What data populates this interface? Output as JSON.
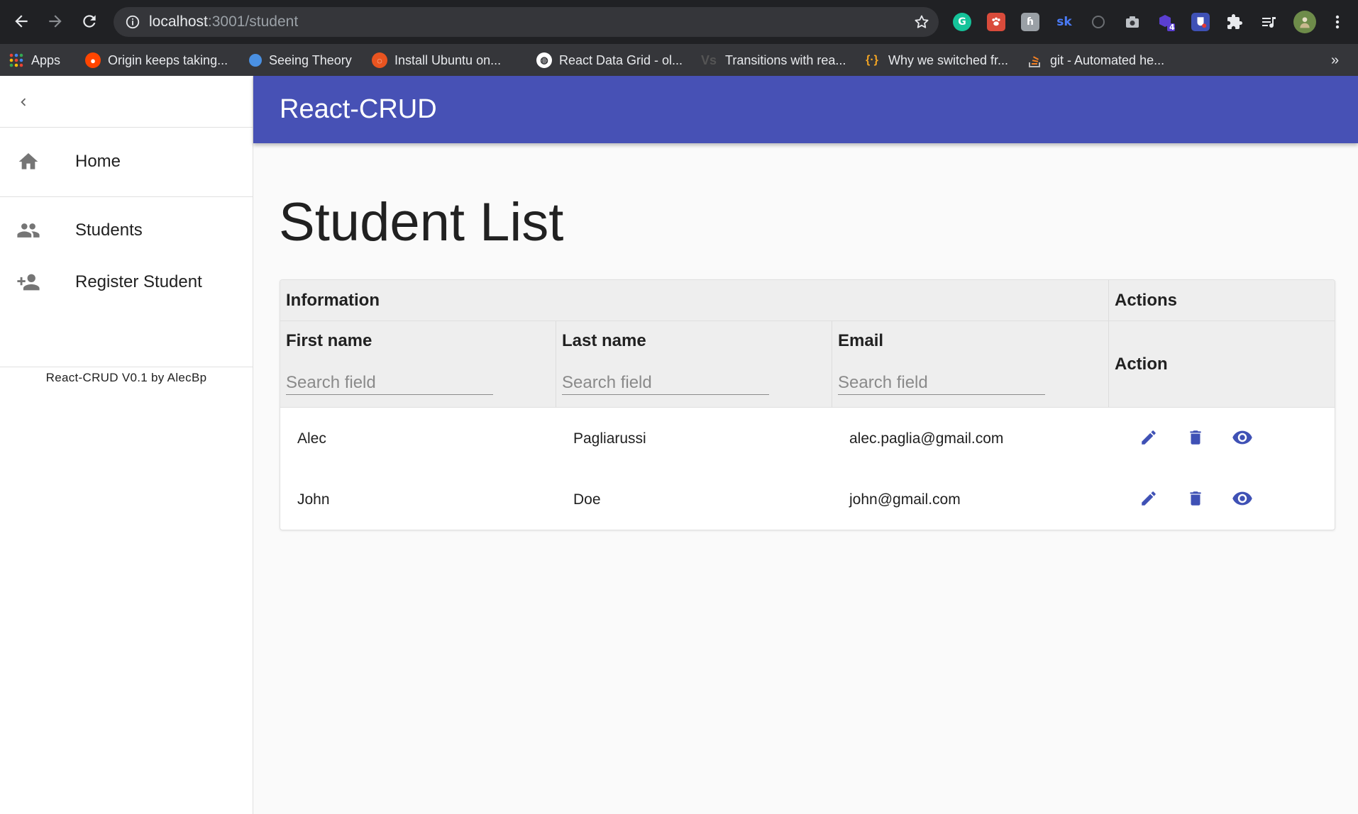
{
  "browser": {
    "url_host": "localhost",
    "url_path": ":3001/student",
    "bookmarks": [
      {
        "label": "Apps",
        "icon": "apps-grid-icon",
        "color": "#4285f4"
      },
      {
        "label": "Origin keeps taking...",
        "icon": "reddit-icon",
        "color": "#ff4500"
      },
      {
        "label": "Seeing Theory",
        "icon": "circle-icon",
        "color": "#4a90e2"
      },
      {
        "label": "Install Ubuntu on...",
        "icon": "ubuntu-icon",
        "color": "#e95420"
      },
      {
        "label": "React Data Grid - ol...",
        "icon": "globe-icon",
        "color": "#ffffff"
      },
      {
        "label": "Transitions with rea...",
        "icon": "vs-icon",
        "color": "#555555"
      },
      {
        "label": "Why we switched fr...",
        "icon": "braces-icon",
        "color": "#f5a623"
      },
      {
        "label": "git - Automated he...",
        "icon": "stackoverflow-icon",
        "color": "#f48024"
      }
    ],
    "overflow_label": "»",
    "extension_badge": "4"
  },
  "app": {
    "title": "React-CRUD",
    "accent_color": "#4751b5"
  },
  "drawer": {
    "items": [
      {
        "label": "Home",
        "icon": "home-icon"
      },
      {
        "label": "Students",
        "icon": "people-icon"
      },
      {
        "label": "Register Student",
        "icon": "person-add-icon"
      }
    ],
    "footer": "React-CRUD V0.1 by AlecBp"
  },
  "main": {
    "page_title": "Student List",
    "table": {
      "group_information": "Information",
      "group_actions": "Actions",
      "columns": [
        {
          "label": "First name",
          "placeholder": "Search field"
        },
        {
          "label": "Last name",
          "placeholder": "Search field"
        },
        {
          "label": "Email",
          "placeholder": "Search field"
        }
      ],
      "action_header": "Action",
      "rows": [
        {
          "first": "Alec",
          "last": "Pagliarussi",
          "email": "alec.paglia@gmail.com"
        },
        {
          "first": "John",
          "last": "Doe",
          "email": "john@gmail.com"
        }
      ],
      "row_actions": [
        "edit-icon",
        "delete-icon",
        "view-icon"
      ]
    }
  }
}
